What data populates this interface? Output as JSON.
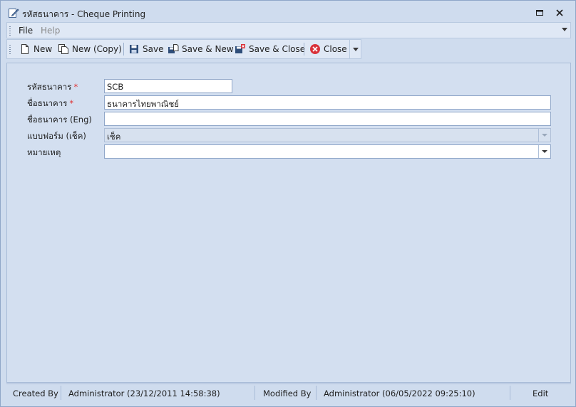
{
  "window": {
    "title": "รหัสธนาคาร - Cheque Printing"
  },
  "menu": {
    "file": "File",
    "help": "Help"
  },
  "toolbar": {
    "new": "New",
    "new_copy": "New (Copy)",
    "save": "Save",
    "save_new": "Save & New",
    "save_close": "Save & Close",
    "close": "Close"
  },
  "form": {
    "bank_code_label": "รหัสธนาคาร",
    "bank_code_value": "SCB",
    "bank_name_label": "ชื่อธนาคาร",
    "bank_name_value": "ธนาคารไทยพาณิชย์",
    "bank_name_eng_label": "ชื่อธนาคาร (Eng)",
    "bank_name_eng_value": "",
    "form_label": "แบบฟอร์ม (เช็ค)",
    "form_value": "เช็ค",
    "remark_label": "หมายเหตุ",
    "remark_value": "",
    "required_mark": "*"
  },
  "status": {
    "created_by_label": "Created By",
    "created_by_value": "Administrator (23/12/2011 14:58:38)",
    "modified_by_label": "Modified By",
    "modified_by_value": "Administrator (06/05/2022 09:25:10)",
    "mode": "Edit"
  },
  "colors": {
    "window_bg": "#cfdcee",
    "content_bg": "#d3dff0",
    "required": "#e03030",
    "close_icon": "#d9323a"
  }
}
